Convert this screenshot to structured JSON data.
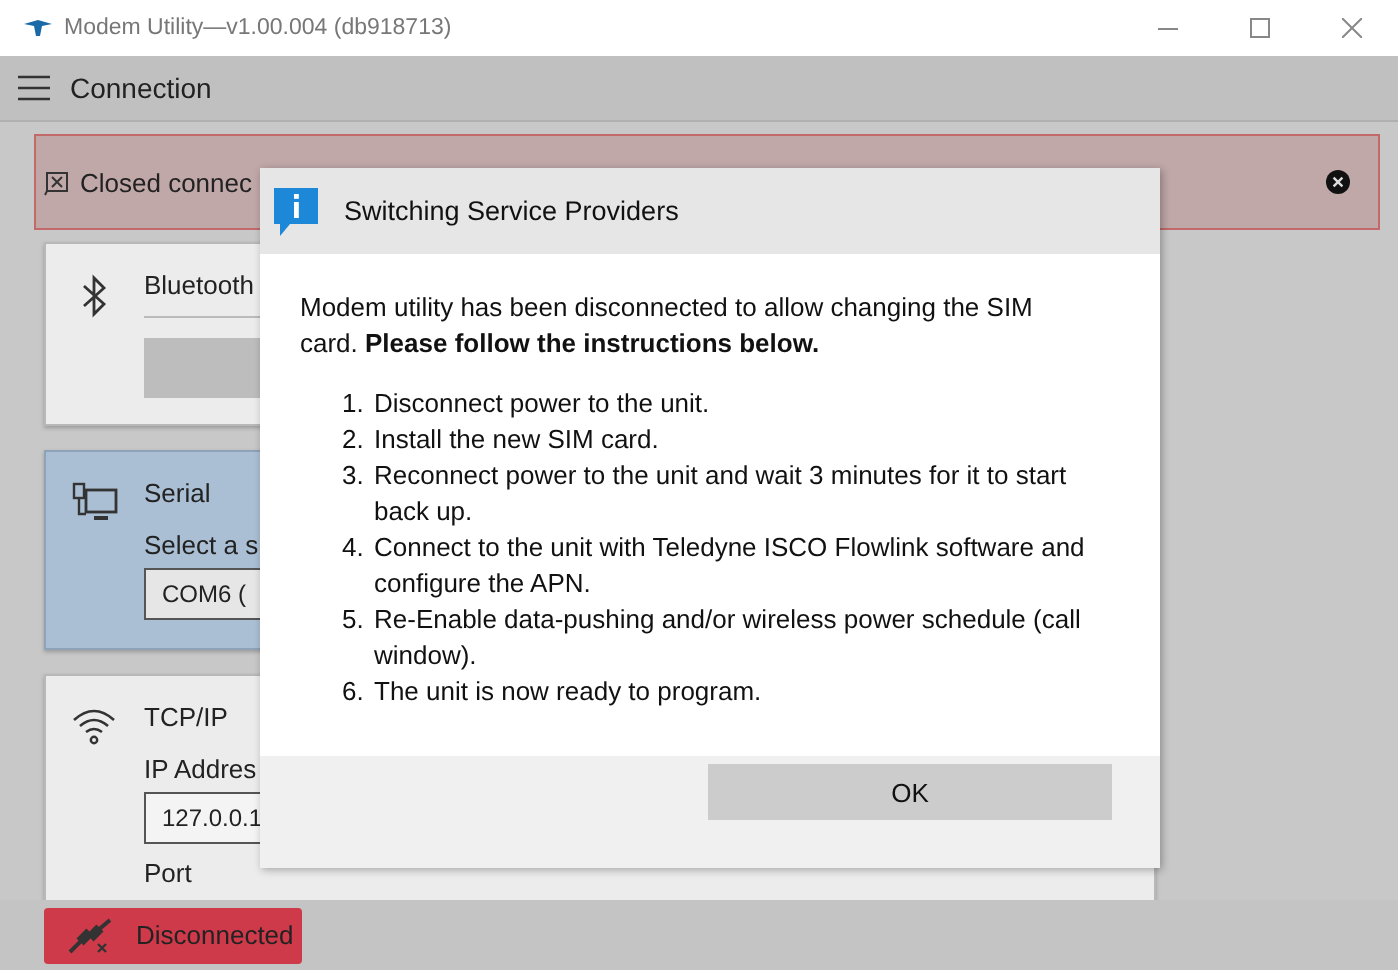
{
  "window": {
    "title": "Modem Utility—v1.00.004 (db918713)"
  },
  "header": {
    "title": "Connection"
  },
  "alert": {
    "text": "Closed connec"
  },
  "cards": [
    {
      "kind": "bluetooth",
      "title": "Bluetooth",
      "selected": false
    },
    {
      "kind": "serial",
      "title": "Serial",
      "selected": true,
      "prompt": "Select a s",
      "value": "COM6 ("
    },
    {
      "kind": "tcp",
      "title": "TCP/IP",
      "selected": false,
      "field_label": "IP Addres",
      "value": "127.0.0.1",
      "port_label": "Port"
    }
  ],
  "status": {
    "label": "Disconnected",
    "connected": false
  },
  "dialog": {
    "title": "Switching Service Providers",
    "intro": "Modem utility has been disconnected to allow changing the SIM card. **Please follow the instructions below.**",
    "steps": [
      {
        "number": "1.",
        "text": "Disconnect power to the unit."
      },
      {
        "number": "2.",
        "text": "Install the new SIM card."
      },
      {
        "number": "3.",
        "text": "Reconnect power to the unit and wait 3 minutes for it to start back up."
      },
      {
        "number": "4.",
        "text": "Connect to the unit with Teledyne ISCO Flowlink software and configure the APN."
      },
      {
        "number": "5.",
        "text": "Re-Enable data-pushing and/or wireless power schedule (call window)."
      },
      {
        "number": "6.",
        "text": "The unit is now ready to program."
      }
    ],
    "button": "OK"
  }
}
